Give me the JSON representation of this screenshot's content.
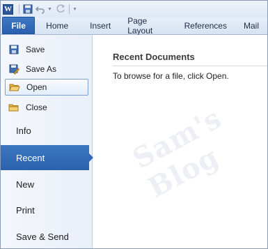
{
  "qat": {
    "app_icon_letter": "W"
  },
  "tabs": {
    "file": "File",
    "items": [
      "Home",
      "Insert",
      "Page Layout",
      "References",
      "Mail"
    ]
  },
  "backstage": {
    "commands": [
      {
        "label": "Save",
        "icon": "save-icon"
      },
      {
        "label": "Save As",
        "icon": "save-as-icon"
      },
      {
        "label": "Open",
        "icon": "open-folder-icon"
      },
      {
        "label": "Close",
        "icon": "close-folder-icon"
      }
    ],
    "nav": [
      "Info",
      "Recent",
      "New",
      "Print",
      "Save & Send"
    ],
    "active_nav": "Recent"
  },
  "content": {
    "heading": "Recent Documents",
    "hint": "To browse for a file, click Open."
  },
  "watermark": "Sam's Blog",
  "colors": {
    "file_tab": "#2a5fae",
    "active_nav": "#2b61ad",
    "panel_bg": "#eef3fa"
  }
}
